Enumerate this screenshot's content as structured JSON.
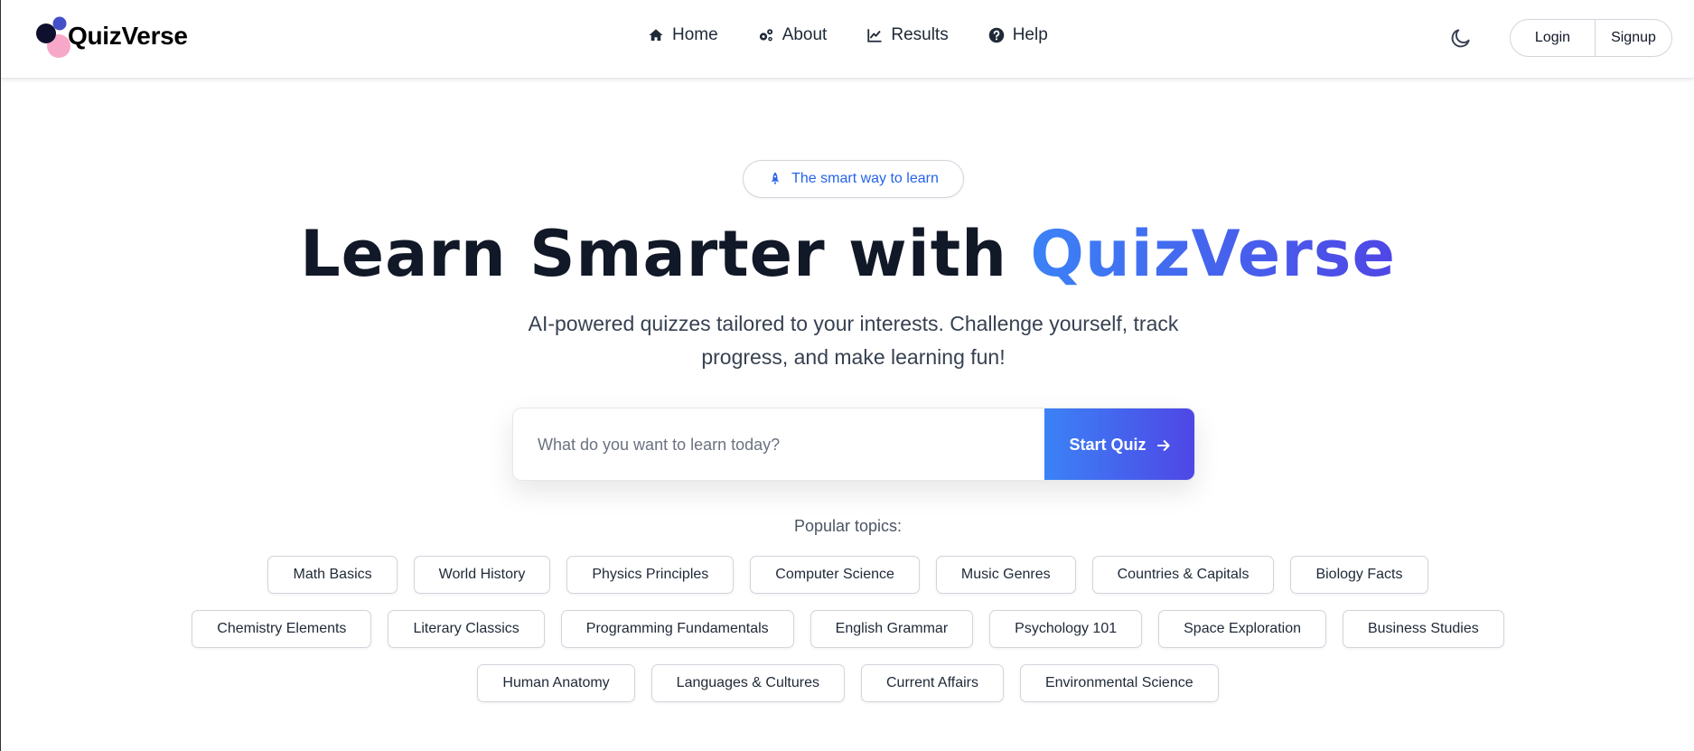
{
  "brand": {
    "name": "QuizVerse",
    "colors": {
      "dot_dark": "#0f0f2e",
      "dot_blue": "#4450c8",
      "dot_pink": "#f7a8c8"
    }
  },
  "nav": {
    "items": [
      {
        "label": "Home",
        "icon": "home-icon"
      },
      {
        "label": "About",
        "icon": "gears-icon"
      },
      {
        "label": "Results",
        "icon": "chart-line-icon"
      },
      {
        "label": "Help",
        "icon": "question-circle-icon"
      }
    ]
  },
  "header": {
    "theme_toggle_icon": "moon-icon",
    "login_label": "Login",
    "signup_label": "Signup"
  },
  "hero": {
    "badge_icon": "rocket-icon",
    "badge_text": "The smart way to learn",
    "title_plain": "Learn Smarter with ",
    "title_accent": "QuizVerse",
    "subtitle": "AI-powered quizzes tailored to your interests. Challenge yourself, track progress, and make learning fun!",
    "accent_gradient": [
      "#3b82f6",
      "#4f46e5"
    ]
  },
  "search": {
    "placeholder": "What do you want to learn today?",
    "value": "",
    "button_label": "Start Quiz",
    "button_icon": "arrow-right-icon"
  },
  "popular": {
    "label": "Popular topics:",
    "rows": [
      [
        "Math Basics",
        "World History",
        "Physics Principles",
        "Computer Science",
        "Music Genres",
        "Countries & Capitals",
        "Biology Facts"
      ],
      [
        "Chemistry Elements",
        "Literary Classics",
        "Programming Fundamentals",
        "English Grammar",
        "Psychology 101",
        "Space Exploration",
        "Business Studies"
      ],
      [
        "Human Anatomy",
        "Languages & Cultures",
        "Current Affairs",
        "Environmental Science"
      ]
    ]
  }
}
